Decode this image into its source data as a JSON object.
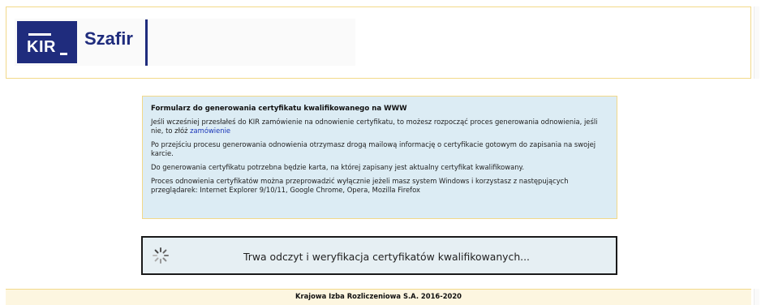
{
  "header": {
    "logo_kir": "KIR",
    "logo_szafir": "Szafir"
  },
  "info": {
    "title": "Formularz do generowania certyfikatu kwalifikowanego na WWW",
    "para1_text": "Jeśli wcześniej przesłałeś do KIR zamówienie na odnowienie certyfikatu, to możesz rozpocząć proces generowania odnowienia, jeśli nie, to złóż ",
    "para1_link": "zamówienie",
    "para2": "Po przejściu procesu generowania odnowienia otrzymasz drogą mailową informację o certyfikacie gotowym do zapisania na swojej karcie.",
    "para3": "Do generowania certyfikatu potrzebna będzie karta, na której zapisany jest aktualny certyfikat kwalifikowany.",
    "para4": "Proces odnowienia certyfikatów można przeprowadzić wyłącznie jeżeli masz system Windows i korzystasz z następujących przeglądarek: Internet Explorer 9/10/11, Google Chrome, Opera, Mozilla Firefox"
  },
  "status": {
    "text": "Trwa odczyt i weryfikacja certyfikatów kwalifikowanych...",
    "icon": "loading-spinner-icon"
  },
  "footer": {
    "text": "Krajowa Izba Rozliczeniowa S.A. 2016-2020"
  },
  "colors": {
    "brand": "#1f2c7d",
    "panel": "#dcecf4",
    "border": "#f2d98a",
    "link": "#1a35b8"
  }
}
